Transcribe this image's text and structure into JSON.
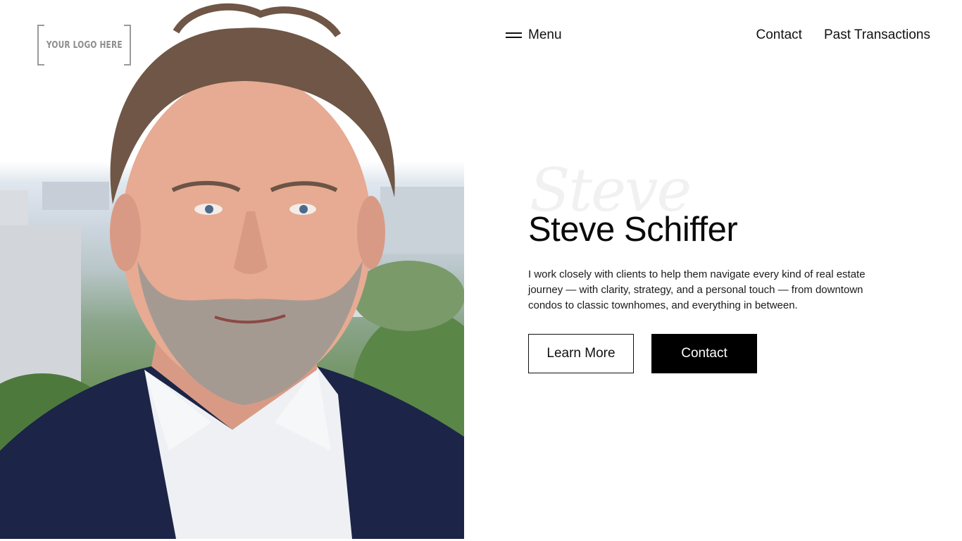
{
  "logo": {
    "text": "YOUR LOGO HERE"
  },
  "nav": {
    "menu_label": "Menu",
    "links": [
      {
        "label": "Contact"
      },
      {
        "label": "Past Transactions"
      }
    ]
  },
  "hero": {
    "script_text": "Steve",
    "name": "Steve Schiffer",
    "bio": "I work closely with clients to help them navigate every kind of real estate journey — with clarity, strategy, and a personal touch — from downtown condos to classic townhomes, and everything in between.",
    "buttons": {
      "learn_more": "Learn More",
      "contact": "Contact"
    }
  },
  "colors": {
    "primary": "#000000",
    "background": "#ffffff",
    "jacket": "#1c2447",
    "shirt": "#eef0f4"
  }
}
